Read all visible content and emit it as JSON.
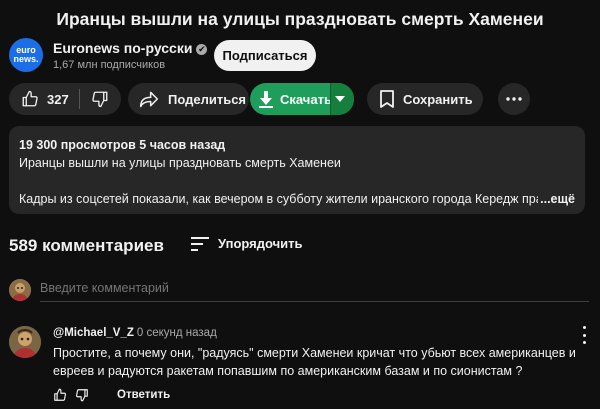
{
  "video": {
    "title": "Иранцы вышли на улицы праздновать смерть Хаменеи"
  },
  "channel": {
    "avatar_line1": "euro",
    "avatar_line2": "news.",
    "name": "Euronews по-русски",
    "verified_icon": "✔",
    "subscribers": "1,67 млн подписчиков",
    "subscribe_label": "Подписаться"
  },
  "actions": {
    "like_count": "327",
    "share_label": "Поделиться",
    "download_label": "Скачать",
    "save_label": "Сохранить",
    "download_color": "#1e9e5a"
  },
  "description": {
    "meta": "19 300 просмотров  5 часов назад",
    "line1": "Иранцы вышли на улицы праздновать смерть Хаменеи",
    "line2": "Кадры из соцсетей показали, как вечером в субботу жители иранского города Кередж праздн",
    "more_label": "...ещё"
  },
  "comments": {
    "count_label": "589 комментариев",
    "sort_label": "Упорядочить",
    "add_placeholder": "Введите комментарий",
    "items": [
      {
        "author": "@Michael_V_Z",
        "time": "0 секунд назад",
        "text": "Простите, а почему  они, \"радуясь\" смерти Хаменеи кричат что убьют всех американцев и евреев и радуются ракетам попавшим по американским базам и по сионистам ?",
        "reply_label": "Ответить"
      }
    ]
  }
}
